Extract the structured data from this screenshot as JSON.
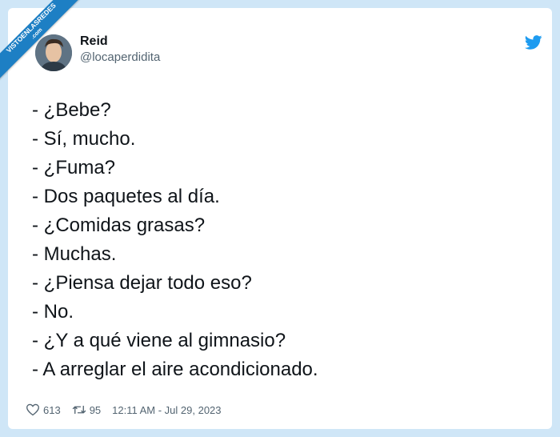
{
  "watermark": {
    "line1": "VISTOENLASREDES",
    "line2": ".com"
  },
  "author": {
    "name": "Reid",
    "handle": "@locaperdidita"
  },
  "tweet": {
    "lines": [
      "- ¿Bebe?",
      "- Sí, mucho.",
      "- ¿Fuma?",
      "- Dos paquetes al día.",
      "- ¿Comidas grasas?",
      "- Muchas.",
      "- ¿Piensa dejar todo eso?",
      "- No.",
      "- ¿Y a qué viene al gimnasio?",
      "- A arreglar el aire acondicionado."
    ]
  },
  "stats": {
    "likes": "613",
    "retweets": "95",
    "timestamp": "12:11 AM - Jul 29, 2023"
  },
  "icons": {
    "platform": "twitter-bird-icon",
    "like": "heart-icon",
    "retweet": "retweet-icon"
  },
  "colors": {
    "brand": "#1d9bf0",
    "ribbon": "#1d7fc4",
    "background": "#cfe6f7"
  }
}
